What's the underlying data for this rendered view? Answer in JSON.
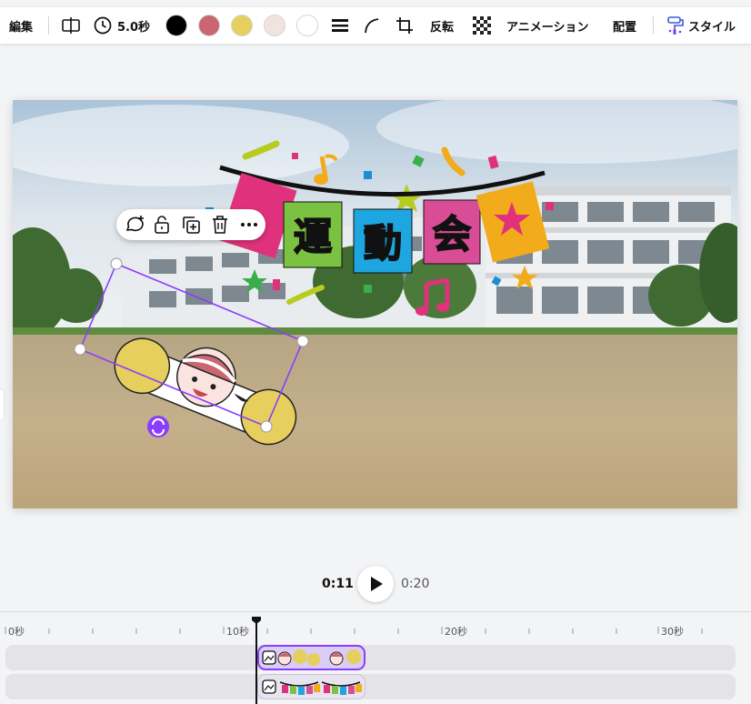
{
  "toolbar": {
    "edit_label": "編集",
    "duration_label": "5.0秒",
    "flip_label": "反転",
    "animate_label": "アニメーション",
    "position_label": "配置",
    "style_label": "スタイル",
    "colors": [
      "#000000",
      "#c9666f",
      "#e6cf5d",
      "#f1e4de",
      "#ffffff"
    ]
  },
  "canvas": {
    "banner_characters": [
      "運",
      "動",
      "会"
    ]
  },
  "element_toolbar": {
    "icons": [
      "comment-add-icon",
      "lock-icon",
      "duplicate-icon",
      "trash-icon",
      "more-icon"
    ]
  },
  "playback": {
    "current_time": "0:11",
    "total_time": "0:20"
  },
  "timeline": {
    "ticks": [
      "0秒",
      "10秒",
      "20秒",
      "30秒"
    ],
    "tracks": [
      {
        "name": "cheer-girl-clip",
        "selected": true
      },
      {
        "name": "sports-day-banner-clip",
        "selected": false
      }
    ]
  }
}
